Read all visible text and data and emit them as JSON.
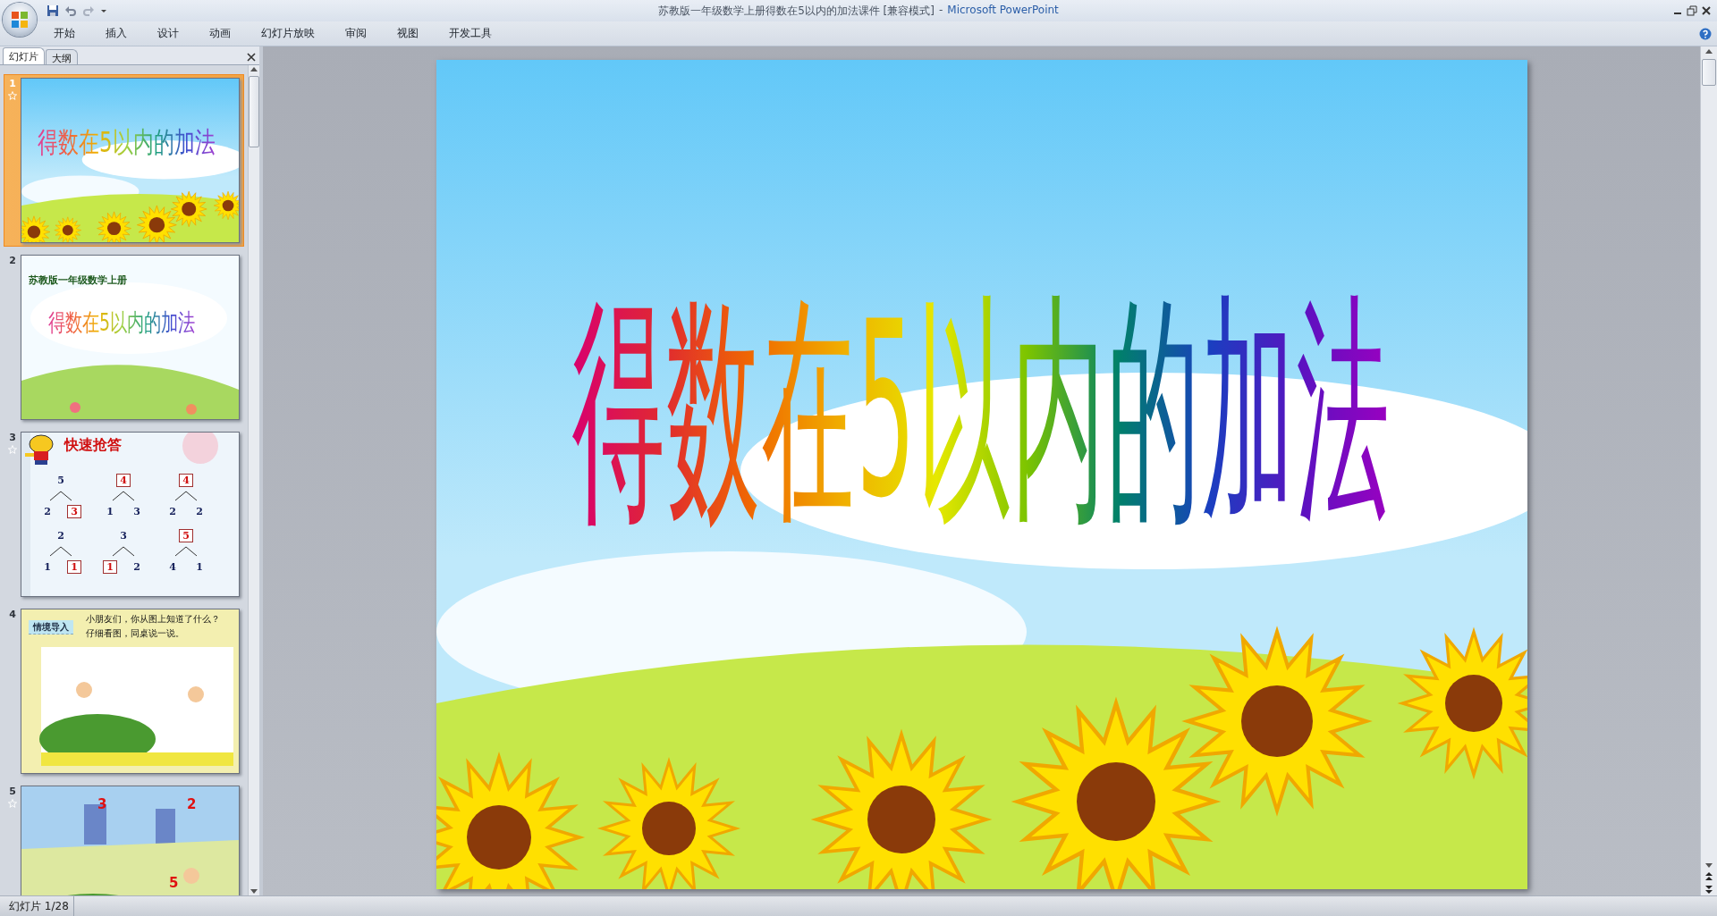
{
  "window": {
    "title": "苏教版一年级数学上册得数在5以内的加法课件 [兼容模式]",
    "separator": "-",
    "app_name": "Microsoft PowerPoint"
  },
  "ribbon_tabs": [
    "开始",
    "插入",
    "设计",
    "动画",
    "幻灯片放映",
    "审阅",
    "视图",
    "开发工具"
  ],
  "panel_tabs": [
    {
      "label": "幻灯片",
      "selected": true
    },
    {
      "label": "大纲",
      "selected": false
    }
  ],
  "slides": [
    {
      "number": "1",
      "selected": true,
      "animated": true,
      "kind": "title",
      "title": "得数在5以内的加法"
    },
    {
      "number": "2",
      "selected": false,
      "animated": false,
      "kind": "cover",
      "subtitle": "苏教版一年级数学上册",
      "title": "得数在5以内的加法"
    },
    {
      "number": "3",
      "selected": false,
      "animated": true,
      "kind": "bonds",
      "title": "快速抢答",
      "bonds": [
        {
          "top": {
            "value": "5",
            "boxed": false
          },
          "left": {
            "value": "2",
            "boxed": false
          },
          "right": {
            "value": "3",
            "boxed": true
          }
        },
        {
          "top": {
            "value": "4",
            "boxed": true
          },
          "left": {
            "value": "1",
            "boxed": false
          },
          "right": {
            "value": "3",
            "boxed": false
          }
        },
        {
          "top": {
            "value": "4",
            "boxed": true
          },
          "left": {
            "value": "2",
            "boxed": false
          },
          "right": {
            "value": "2",
            "boxed": false
          }
        },
        {
          "top": {
            "value": "2",
            "boxed": false
          },
          "left": {
            "value": "1",
            "boxed": false
          },
          "right": {
            "value": "1",
            "boxed": true
          }
        },
        {
          "top": {
            "value": "3",
            "boxed": false
          },
          "left": {
            "value": "1",
            "boxed": true
          },
          "right": {
            "value": "2",
            "boxed": false
          }
        },
        {
          "top": {
            "value": "5",
            "boxed": true
          },
          "left": {
            "value": "4",
            "boxed": false
          },
          "right": {
            "value": "1",
            "boxed": false
          }
        }
      ]
    },
    {
      "number": "4",
      "selected": false,
      "animated": false,
      "kind": "scene",
      "label": "情境导入",
      "lines": [
        "小朋友们，你从图上知道了什么？",
        "仔细看图，同桌说一说。"
      ]
    },
    {
      "number": "5",
      "selected": false,
      "animated": true,
      "kind": "counts",
      "counts": [
        "3",
        "2",
        "5"
      ]
    }
  ],
  "current_slide": {
    "title": "得数在5以内的加法"
  },
  "status_bar": {
    "slide_counter": "幻灯片 1/28"
  }
}
